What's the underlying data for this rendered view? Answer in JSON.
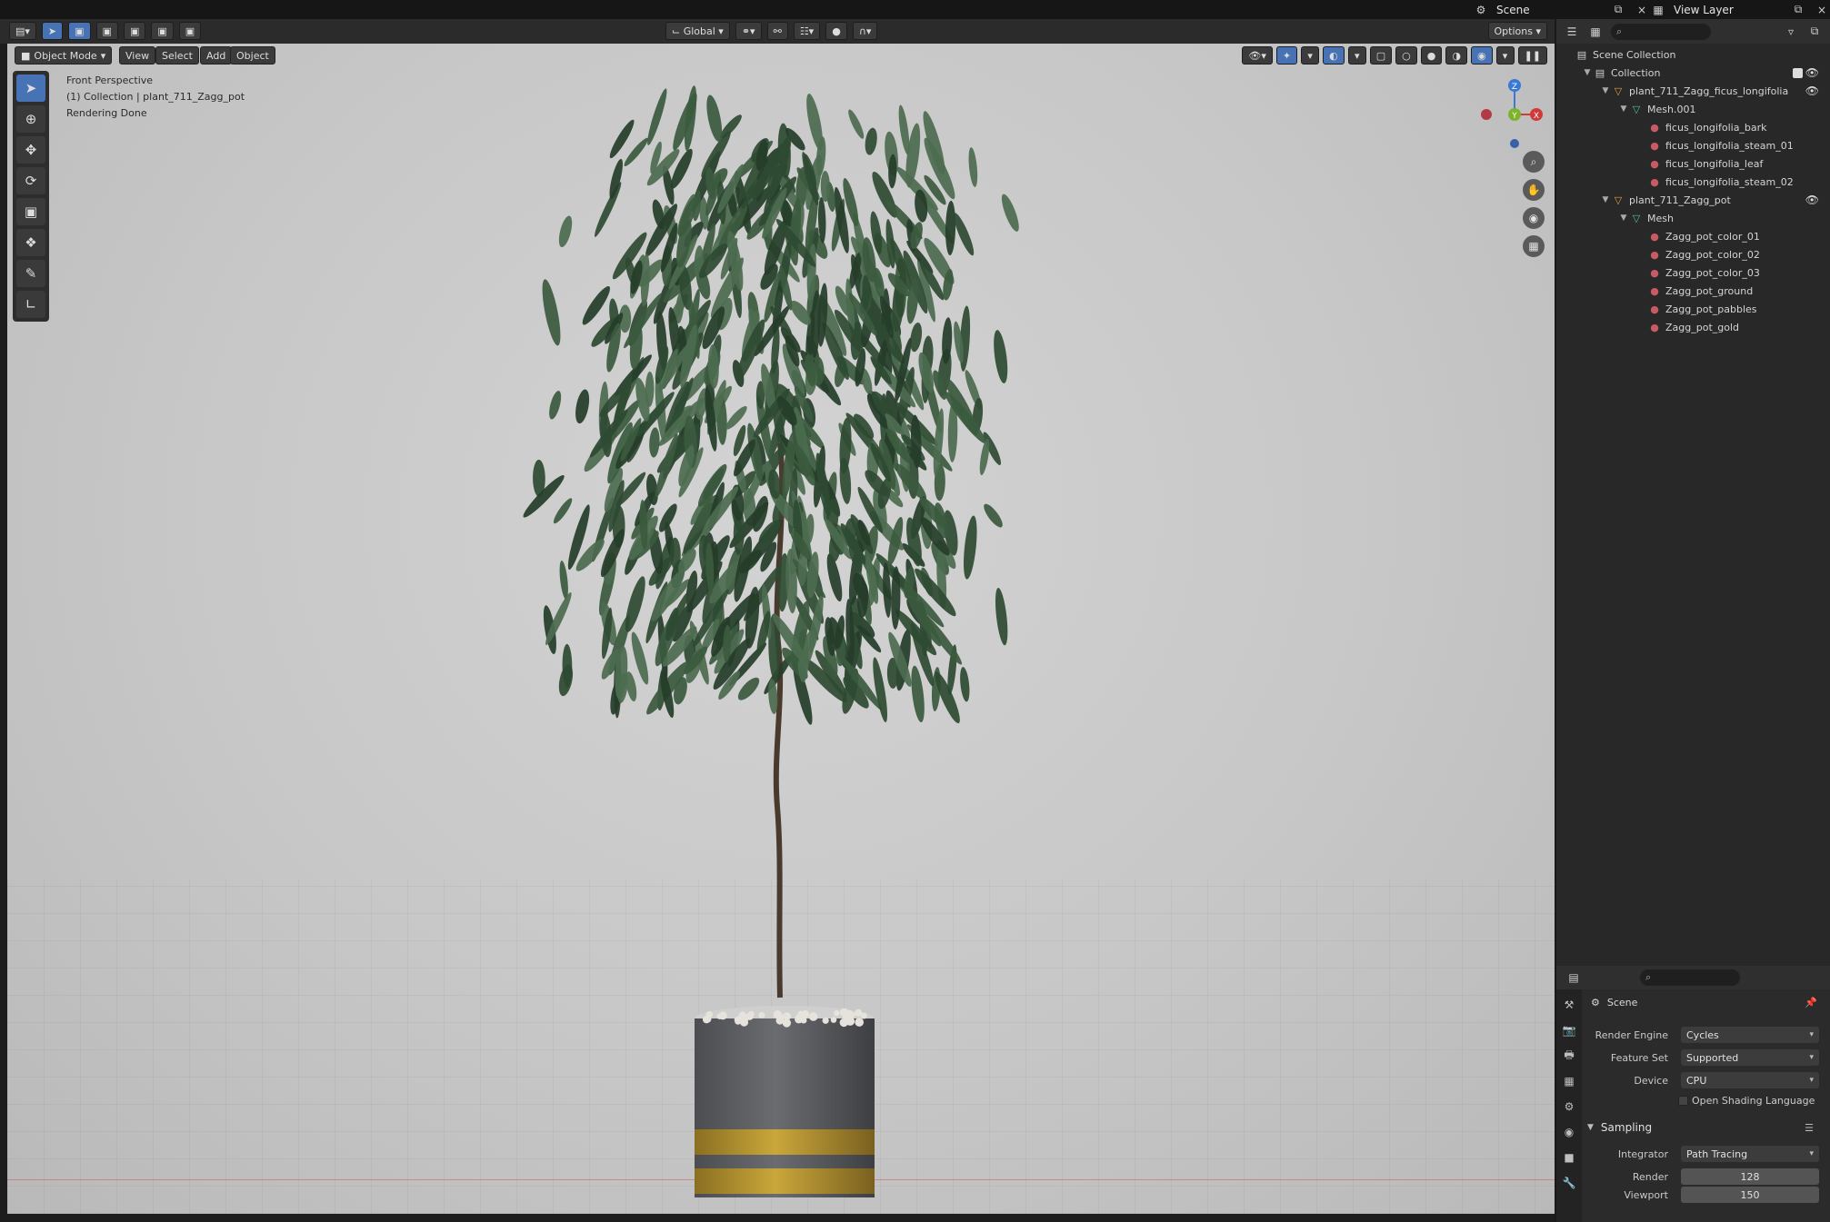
{
  "topbar": {
    "scene": "Scene",
    "view_layer": "View Layer"
  },
  "header": {
    "transform_orientation": "Global",
    "options": "Options"
  },
  "viewport": {
    "mode": "Object Mode",
    "menus": [
      "View",
      "Select",
      "Add",
      "Object"
    ],
    "overlay_lines": [
      "Front Perspective",
      "(1) Collection | plant_711_Zagg_pot",
      "Rendering Done"
    ],
    "gizmo": {
      "z": "Z",
      "y": "Y",
      "x": "X"
    }
  },
  "outliner": {
    "search_placeholder": "",
    "items": [
      {
        "label": "Scene Collection",
        "depth": 0,
        "icon": "scene-collection-icon"
      },
      {
        "label": "Collection",
        "depth": 1,
        "icon": "collection-icon"
      },
      {
        "label": "plant_711_Zagg_ficus_longifolia",
        "depth": 2,
        "icon": "object-icon"
      },
      {
        "label": "Mesh.001",
        "depth": 3,
        "icon": "mesh-icon"
      },
      {
        "label": "ficus_longifolia_bark",
        "depth": 4,
        "icon": "material-icon"
      },
      {
        "label": "ficus_longifolia_steam_01",
        "depth": 4,
        "icon": "material-icon"
      },
      {
        "label": "ficus_longifolia_leaf",
        "depth": 4,
        "icon": "material-icon"
      },
      {
        "label": "ficus_longifolia_steam_02",
        "depth": 4,
        "icon": "material-icon"
      },
      {
        "label": "plant_711_Zagg_pot",
        "depth": 2,
        "icon": "object-icon"
      },
      {
        "label": "Mesh",
        "depth": 3,
        "icon": "mesh-icon"
      },
      {
        "label": "Zagg_pot_color_01",
        "depth": 4,
        "icon": "material-icon"
      },
      {
        "label": "Zagg_pot_color_02",
        "depth": 4,
        "icon": "material-icon"
      },
      {
        "label": "Zagg_pot_color_03",
        "depth": 4,
        "icon": "material-icon"
      },
      {
        "label": "Zagg_pot_ground",
        "depth": 4,
        "icon": "material-icon"
      },
      {
        "label": "Zagg_pot_pabbles",
        "depth": 4,
        "icon": "material-icon"
      },
      {
        "label": "Zagg_pot_gold",
        "depth": 4,
        "icon": "material-icon"
      }
    ]
  },
  "properties": {
    "title": "Scene",
    "render_engine_label": "Render Engine",
    "render_engine": "Cycles",
    "feature_set_label": "Feature Set",
    "feature_set": "Supported",
    "device_label": "Device",
    "device": "CPU",
    "osl_label": "Open Shading Language",
    "sampling_label": "Sampling",
    "integrator_label": "Integrator",
    "integrator": "Path Tracing",
    "render_label": "Render",
    "render_value": "128",
    "viewport_label": "Viewport",
    "viewport_value": "150"
  },
  "colors": {
    "accent": "#4772b3",
    "leaf_dark": "#2e4a32",
    "leaf_light": "#4c6b4f",
    "pot": "#5b5d60",
    "gold": "#b9962f",
    "material_red": "#c85a66",
    "object_orange": "#e59a49",
    "mesh_teal": "#4fc2a8"
  }
}
